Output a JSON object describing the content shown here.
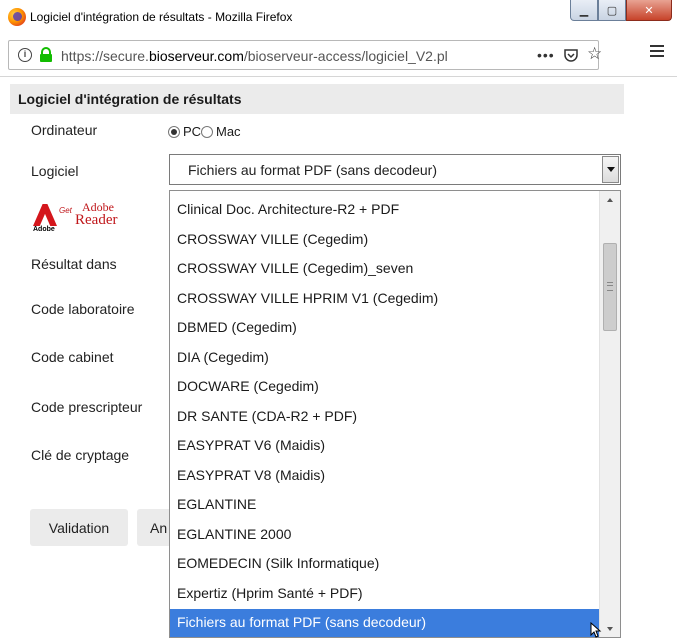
{
  "window": {
    "title": "Logiciel d'intégration de résultats - Mozilla Firefox"
  },
  "addressbar": {
    "url_prefix": "https://secure.",
    "url_domain": "bioserveur.com",
    "url_path": "/bioserveur-access/logiciel_V2.pl",
    "more": "•••"
  },
  "form": {
    "header": "Logiciel d'intégration de résultats",
    "ordinateur_label": "Ordinateur",
    "pc_label": "PC",
    "mac_label": "Mac",
    "selected_platform": "PC",
    "logiciel_label": "Logiciel",
    "logiciel_value": "Fichiers au format PDF (sans decodeur)",
    "adobe": {
      "get": "Get",
      "adobe": "Adobe",
      "reader": "Reader",
      "small": "Adobe"
    },
    "resultat_label": "Résultat dans",
    "code_labo_label": "Code laboratoire",
    "code_cabinet_label": "Code cabinet",
    "code_prescripteur_label": "Code prescripteur",
    "cle_label": "Clé de cryptage",
    "validation_button": "Validation",
    "second_button": "An"
  },
  "dropdown": {
    "options": [
      "Clinical Doc. Architecture-R2 + PDF",
      "CROSSWAY VILLE (Cegedim)",
      "CROSSWAY VILLE (Cegedim)_seven",
      "CROSSWAY VILLE HPRIM V1 (Cegedim)",
      "DBMED (Cegedim)",
      "DIA (Cegedim)",
      "DOCWARE (Cegedim)",
      "DR SANTE (CDA-R2 + PDF)",
      "EASYPRAT V6 (Maidis)",
      "EASYPRAT V8 (Maidis)",
      "EGLANTINE",
      "EGLANTINE 2000",
      "EOMEDECIN (Silk Informatique)",
      "Expertiz (Hprim Santé + PDF)",
      "Fichiers au format PDF (sans decodeur)"
    ],
    "selected_index": 14
  },
  "colors": {
    "highlight": "#3b7ddd",
    "header_bg": "#ebebeb",
    "adobe_red": "#c0171b"
  }
}
